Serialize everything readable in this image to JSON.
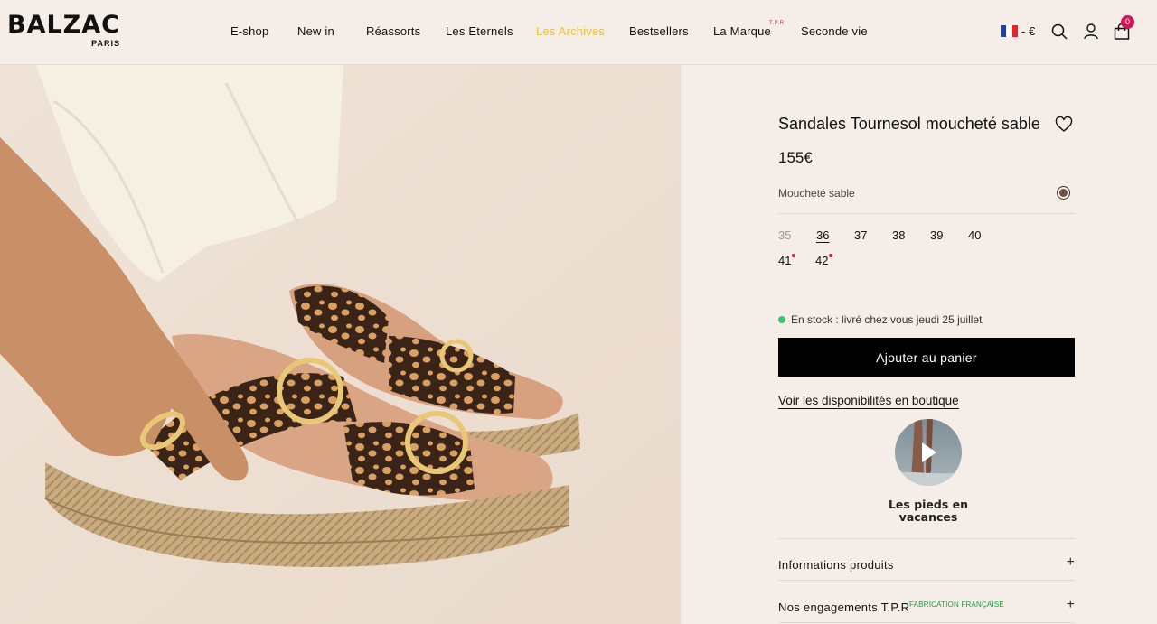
{
  "brand": {
    "name": "BALZAC",
    "sub": "PARIS"
  },
  "nav": [
    {
      "label": "E-shop"
    },
    {
      "label": "New in"
    },
    {
      "label": "Réassorts"
    },
    {
      "label": "Les Eternels"
    },
    {
      "label": "Les Archives"
    },
    {
      "label": "Bestsellers"
    },
    {
      "label": "La Marque",
      "sup": "T.P.R"
    },
    {
      "label": "Seconde vie"
    }
  ],
  "header": {
    "currency": "- €",
    "cart_count": "0"
  },
  "product": {
    "title": "Sandales Tournesol moucheté sable",
    "price": "155€",
    "color_name": "Moucheté sable",
    "sizes": [
      {
        "label": "35",
        "state": "unavailable"
      },
      {
        "label": "36",
        "state": "selected"
      },
      {
        "label": "37",
        "state": "available"
      },
      {
        "label": "38",
        "state": "available"
      },
      {
        "label": "39",
        "state": "available"
      },
      {
        "label": "40",
        "state": "available"
      },
      {
        "label": "41",
        "state": "low-stock"
      },
      {
        "label": "42",
        "state": "low-stock"
      }
    ],
    "stock": "En stock : livré chez vous jeudi 25 juillet",
    "add_to_cart": "Ajouter au panier",
    "store_link": "Voir les disponibilités en boutique",
    "story_label_1": "Les pieds en",
    "story_label_2": "vacances",
    "accordions": [
      {
        "label": "Informations produits"
      },
      {
        "label": "Nos engagements T.P.R",
        "tag": "FABRICATION FRANÇAISE"
      }
    ]
  },
  "colors": {
    "background": "#f5ede7",
    "accent_pink": "#d4145a",
    "active_nav": "#f1c232",
    "stock_green": "#3cc46a",
    "button_black": "#000000"
  },
  "icons": [
    "flag-fr-icon",
    "search-icon",
    "account-icon",
    "cart-icon",
    "heart-icon",
    "play-icon",
    "plus-icon"
  ]
}
